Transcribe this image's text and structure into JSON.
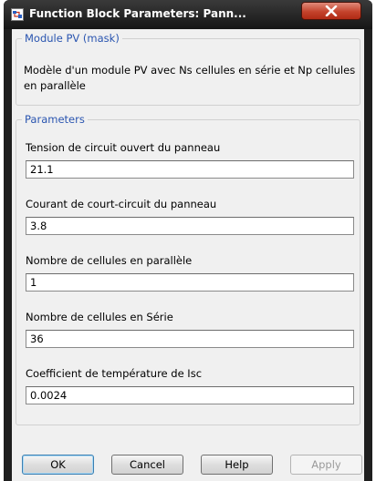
{
  "window": {
    "title": "Function Block Parameters: Pann..."
  },
  "mask_group": {
    "legend": "Module PV (mask)",
    "description": "Modèle d'un module PV avec Ns cellules en série et Np cellules en parallèle"
  },
  "parameters": {
    "legend": "Parameters",
    "fields": [
      {
        "label": "Tension de circuit ouvert du panneau",
        "value": "21.1"
      },
      {
        "label": "Courant de court-circuit du panneau",
        "value": "3.8"
      },
      {
        "label": "Nombre de cellules en parallèle",
        "value": "1"
      },
      {
        "label": "Nombre de cellules en Série",
        "value": "36"
      },
      {
        "label": "Coefficient de température de Isc",
        "value": "0.0024"
      }
    ]
  },
  "buttons": {
    "ok": "OK",
    "cancel": "Cancel",
    "help": "Help",
    "apply": "Apply"
  },
  "colors": {
    "titlebar": "#1f1f1f",
    "legend_text": "#2a55b0",
    "close_button": "#c4432c"
  },
  "icons": {
    "window_icon": "simulink-block-icon",
    "close": "close-icon"
  }
}
